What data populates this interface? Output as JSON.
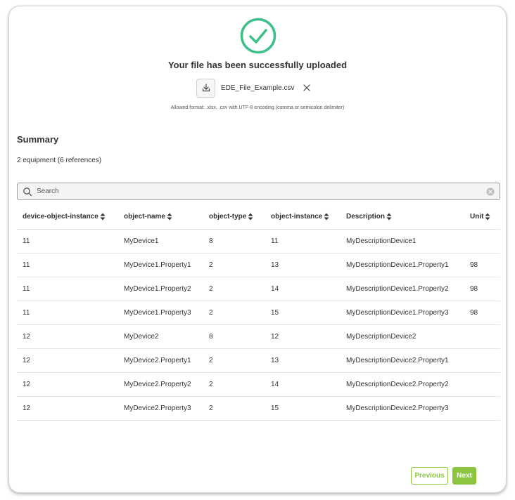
{
  "colors": {
    "accent": "#8cc63f",
    "success": "#3dbf8a"
  },
  "upload": {
    "status_icon": "check-circle-icon",
    "title": "Your file has been successfully uploaded",
    "file_name": "EDE_File_Example.csv",
    "allowed_format": "Allowed format: .xlsx, .csv with UTF-8 encoding (comma or semicolon delimiter)"
  },
  "summary": {
    "title": "Summary",
    "count": "2 equipment (6 references)"
  },
  "search": {
    "placeholder": "Search"
  },
  "table": {
    "columns": [
      "device-object-instance",
      "object-name",
      "object-type",
      "object-instance",
      "Description",
      "Unit"
    ],
    "rows": [
      [
        "11",
        "MyDevice1",
        "8",
        "11",
        "MyDescriptionDevice1",
        ""
      ],
      [
        "11",
        "MyDevice1.Property1",
        "2",
        "13",
        "MyDescriptionDevice1.Property1",
        "98"
      ],
      [
        "11",
        "MyDevice1.Property2",
        "2",
        "14",
        "MyDescriptionDevice1.Property2",
        "98"
      ],
      [
        "11",
        "MyDevice1.Property3",
        "2",
        "15",
        "MyDescriptionDevice1.Property3",
        "98"
      ],
      [
        "12",
        "MyDevice2",
        "8",
        "12",
        "MyDescriptionDevice2",
        ""
      ],
      [
        "12",
        "MyDevice2.Property1",
        "2",
        "13",
        "MyDescriptionDevice2.Property1",
        ""
      ],
      [
        "12",
        "MyDevice2.Property2",
        "2",
        "14",
        "MyDescriptionDevice2.Property2",
        ""
      ],
      [
        "12",
        "MyDevice2.Property3",
        "2",
        "15",
        "MyDescriptionDevice2.Property3",
        ""
      ]
    ]
  },
  "buttons": {
    "previous": "Previous",
    "next": "Next"
  }
}
